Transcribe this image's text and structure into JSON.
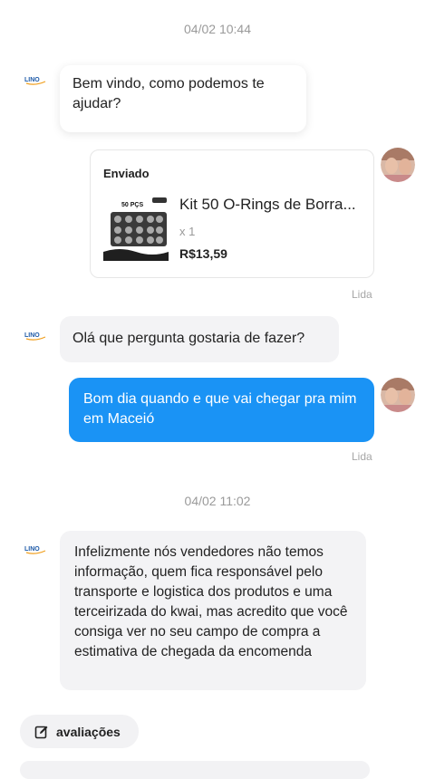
{
  "timestamps": [
    "04/02 10:44",
    "04/02 11:02"
  ],
  "seller_logo_text": "LINO",
  "messages": {
    "welcome": "Bem vindo, como podemos te ajudar?",
    "question_prompt": "Olá que pergunta gostaria de fazer?",
    "user_question": "Bom dia quando e que vai chegar pra mim em Maceió",
    "seller_answer": "Infelizmente nós vendedores não temos informação, quem fica responsável pelo transporte e logistica dos produtos e uma terceirizada do kwai, mas acredito que você consiga ver no seu campo de compra a estimativa de chegada da encomenda"
  },
  "product_card": {
    "status": "Enviado",
    "title": "Kit 50 O-Rings de Borra...",
    "quantity": "x 1",
    "price": "R$13,59",
    "image_label": "50 PÇS"
  },
  "read_label": "Lida",
  "reviews_button": "avaliações",
  "icons": {
    "seller": "seller-logo-icon",
    "avatar": "user-avatar",
    "edit": "edit-icon"
  },
  "colors": {
    "outgoing_bubble": "#1a93f5",
    "incoming_bubble": "#f3f3f5"
  }
}
